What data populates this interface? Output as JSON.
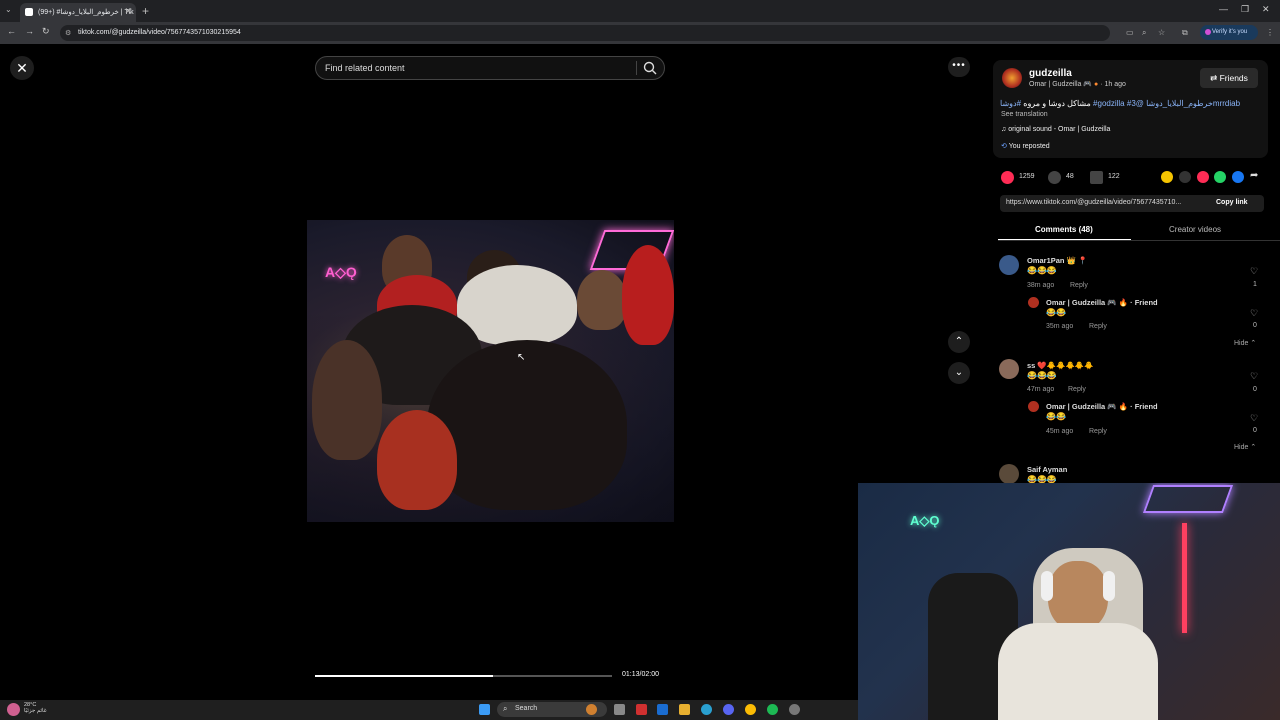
{
  "browser": {
    "tab_title": "(99+) #خرطوم_البلايا_دوشا | Tik",
    "url": "tiktok.com/@gudzeilla/video/7567743571030215954",
    "verify_label": "Verify it's you"
  },
  "search": {
    "placeholder": "Find related content"
  },
  "player": {
    "time": "01:13/02:00",
    "progress": 0.6
  },
  "creator": {
    "username": "gudzeilla",
    "display_name": "Omar | Gudzeilla",
    "time_ago": "· 1h ago",
    "friends_label": "Friends"
  },
  "caption": {
    "text": "مشاكل دوشا و مروه",
    "tags": "#دوشا #godzilla #خرطوم_البلايا_دوشا @3mrrdiab",
    "see_translation": "See translation"
  },
  "sound": "original sound - Omar | Gudzeilla",
  "reposted": "You reposted",
  "stats": {
    "likes": "1259",
    "comments": "48",
    "saves": "122"
  },
  "share_link": "https://www.tiktok.com/@gudzeilla/video/75677435710...",
  "copy_link": "Copy link",
  "tabs": {
    "comments": "Comments (48)",
    "creator_videos": "Creator videos"
  },
  "comments": [
    {
      "name": "Omar1Pan 👑 📍",
      "text": "😂😂😂",
      "time": "38m ago",
      "reply": "Reply",
      "likes": "1",
      "reply_item": {
        "name": "Omar | Gudzeilla 🎮 🔥 · Friend",
        "text": "😂😂",
        "time": "35m ago",
        "reply": "Reply",
        "likes": "0"
      },
      "hide": "Hide ⌃"
    },
    {
      "name": "ss ❤️🐥🐥🐥🐥🐥",
      "text": "😂😂😂",
      "time": "47m ago",
      "reply": "Reply",
      "likes": "0",
      "reply_item": {
        "name": "Omar | Gudzeilla 🎮 🔥 · Friend",
        "text": "😂😂",
        "time": "45m ago",
        "reply": "Reply",
        "likes": "0"
      },
      "hide": "Hide ⌃"
    },
    {
      "name": "Saif Ayman",
      "text": "😂😂😂"
    }
  ],
  "taskbar": {
    "search_label": "Search",
    "weather_temp": "28°C",
    "weather_desc": "غائم جزئيًا"
  },
  "colors": {
    "like": "#fe2c55",
    "link": "#8ab4f8",
    "accent": "#d04fd6"
  }
}
